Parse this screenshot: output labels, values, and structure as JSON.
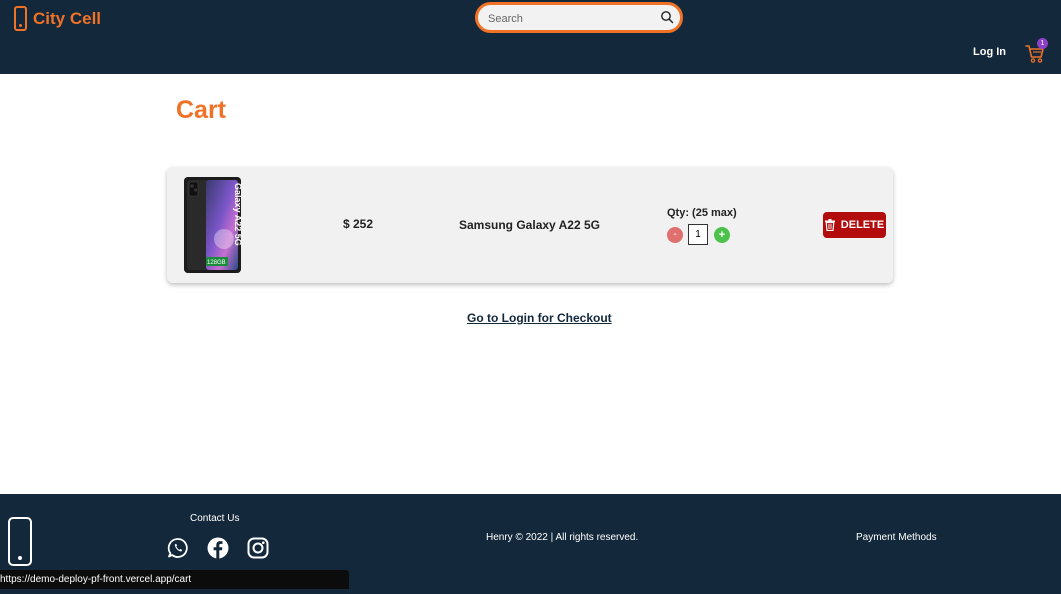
{
  "header": {
    "brand": "City Cell",
    "search_placeholder": "Search",
    "login_label": "Log In",
    "cart_count": "1"
  },
  "cart": {
    "title": "Cart",
    "items": [
      {
        "price": "$ 252",
        "name": "Samsung Galaxy A22 5G",
        "qty_label": "Qty: (25 max)",
        "qty_value": "1",
        "minus_label": "-",
        "plus_label": "+",
        "delete_label": "DELETE",
        "image_text": "Galaxy A22 5G",
        "image_storage": "128GB"
      }
    ],
    "checkout_label": "Go to Login for Checkout"
  },
  "footer": {
    "contact_label": "Contact Us",
    "copyright": "Henry © 2022 | All rights reserved.",
    "payment_label": "Payment Methods"
  },
  "status_bar": {
    "url": "https://demo-deploy-pf-front.vercel.app/cart"
  },
  "colors": {
    "header_bg": "#13283a",
    "accent": "#f07226",
    "delete_red": "#b30c0c",
    "plus_green": "#4cc24c",
    "minus_red": "#e07070",
    "badge_purple": "#8e3fc7"
  },
  "icons": [
    "phone-logo-icon",
    "search-icon",
    "cart-icon",
    "trash-icon",
    "whatsapp-icon",
    "facebook-icon",
    "instagram-icon",
    "phone-footer-icon"
  ]
}
